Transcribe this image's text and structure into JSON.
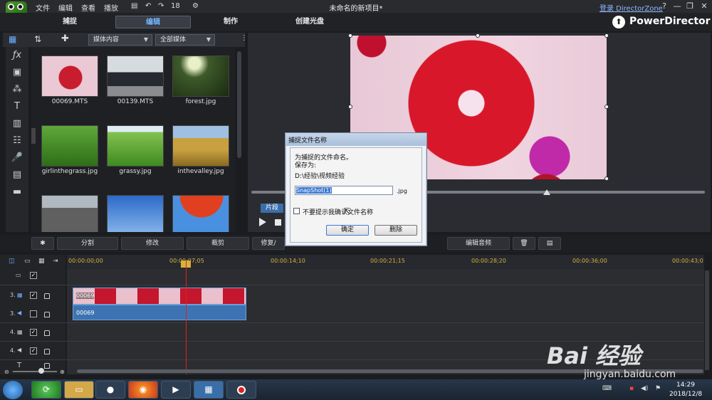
{
  "menubar": {
    "items": [
      "文件",
      "编辑",
      "查看",
      "播放"
    ],
    "window_title": "未命名的新项目*",
    "login_link": "登录 DirectorZone",
    "help": "?",
    "minimize": "—",
    "maximize": "❐",
    "close": "✕",
    "undo_count": "18"
  },
  "tabs": [
    "捕捉",
    "编辑",
    "制作",
    "创建光盘"
  ],
  "active_tab": "编辑",
  "brand": "PowerDirector",
  "library": {
    "dropdown_content": "媒体内容",
    "dropdown_filter": "全部媒体",
    "items": [
      {
        "name": "00069.MTS"
      },
      {
        "name": "00139.MTS"
      },
      {
        "name": "forest.jpg"
      },
      {
        "name": "girlinthegrass.jpg"
      },
      {
        "name": "grassy.jpg"
      },
      {
        "name": "inthevalley.jpg"
      },
      {
        "name": ""
      },
      {
        "name": ""
      },
      {
        "name": ""
      }
    ]
  },
  "preview": {
    "clip_tab": "片段"
  },
  "edit_toolbar": {
    "split": "分割",
    "modify": "修改",
    "trim": "裁剪",
    "repair": "修复/",
    "edit_audio": "编辑音频"
  },
  "timeline": {
    "ruler": [
      "00:00:00;00",
      "00:00:07;05",
      "00:00:14;10",
      "00:00:21;15",
      "00:00:28;20",
      "00:00:36;00",
      "00:00:43;0"
    ],
    "tracks": [
      {
        "num": "3."
      },
      {
        "num": "3."
      },
      {
        "num": "4."
      },
      {
        "num": "4."
      }
    ],
    "video_clip_label": "00069",
    "audio_clip_label": "00069"
  },
  "dialog": {
    "title": "捕捉文件名称",
    "prompt": "为捕捉的文件命名。",
    "save_as_label": "保存为:",
    "save_path": "D:\\经验\\视频经验",
    "filename_value": "SnapShot(1)",
    "extension": ".jpg",
    "dont_show": "不要提示我确认文件名称",
    "ok": "确定",
    "cancel": "删除"
  },
  "taskbar": {
    "time": "14:29",
    "date": "2018/12/8"
  },
  "watermark": {
    "main": "Bai 经验",
    "sub": "jingyan.baidu.com"
  }
}
